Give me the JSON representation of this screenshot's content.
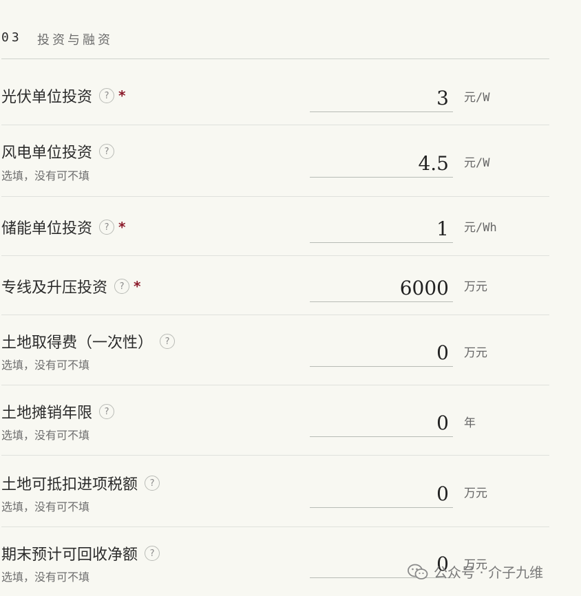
{
  "section": {
    "number": "03",
    "title": "投资与融资"
  },
  "optional_hint": "选填，没有可不填",
  "rows": [
    {
      "label": "光伏单位投资",
      "required": true,
      "hint": "",
      "value": "3",
      "unit": "元/W"
    },
    {
      "label": "风电单位投资",
      "required": false,
      "hint": "选填，没有可不填",
      "value": "4.5",
      "unit": "元/W"
    },
    {
      "label": "储能单位投资",
      "required": true,
      "hint": "",
      "value": "1",
      "unit": "元/Wh"
    },
    {
      "label": "专线及升压投资",
      "required": true,
      "hint": "",
      "value": "6000",
      "unit": "万元"
    },
    {
      "label": "土地取得费（一次性）",
      "required": false,
      "hint": "选填，没有可不填",
      "value": "0",
      "unit": "万元"
    },
    {
      "label": "土地摊销年限",
      "required": false,
      "hint": "选填，没有可不填",
      "value": "0",
      "unit": "年"
    },
    {
      "label": "土地可抵扣进项税额",
      "required": false,
      "hint": "选填，没有可不填",
      "value": "0",
      "unit": "万元"
    },
    {
      "label": "期末预计可回收净额",
      "required": false,
      "hint": "选填，没有可不填",
      "value": "0",
      "unit": "万元"
    }
  ],
  "help_glyph": "?",
  "required_mark": "*",
  "watermark": {
    "text": "公众号 · 介子九维",
    "icon": "wechat-icon"
  }
}
